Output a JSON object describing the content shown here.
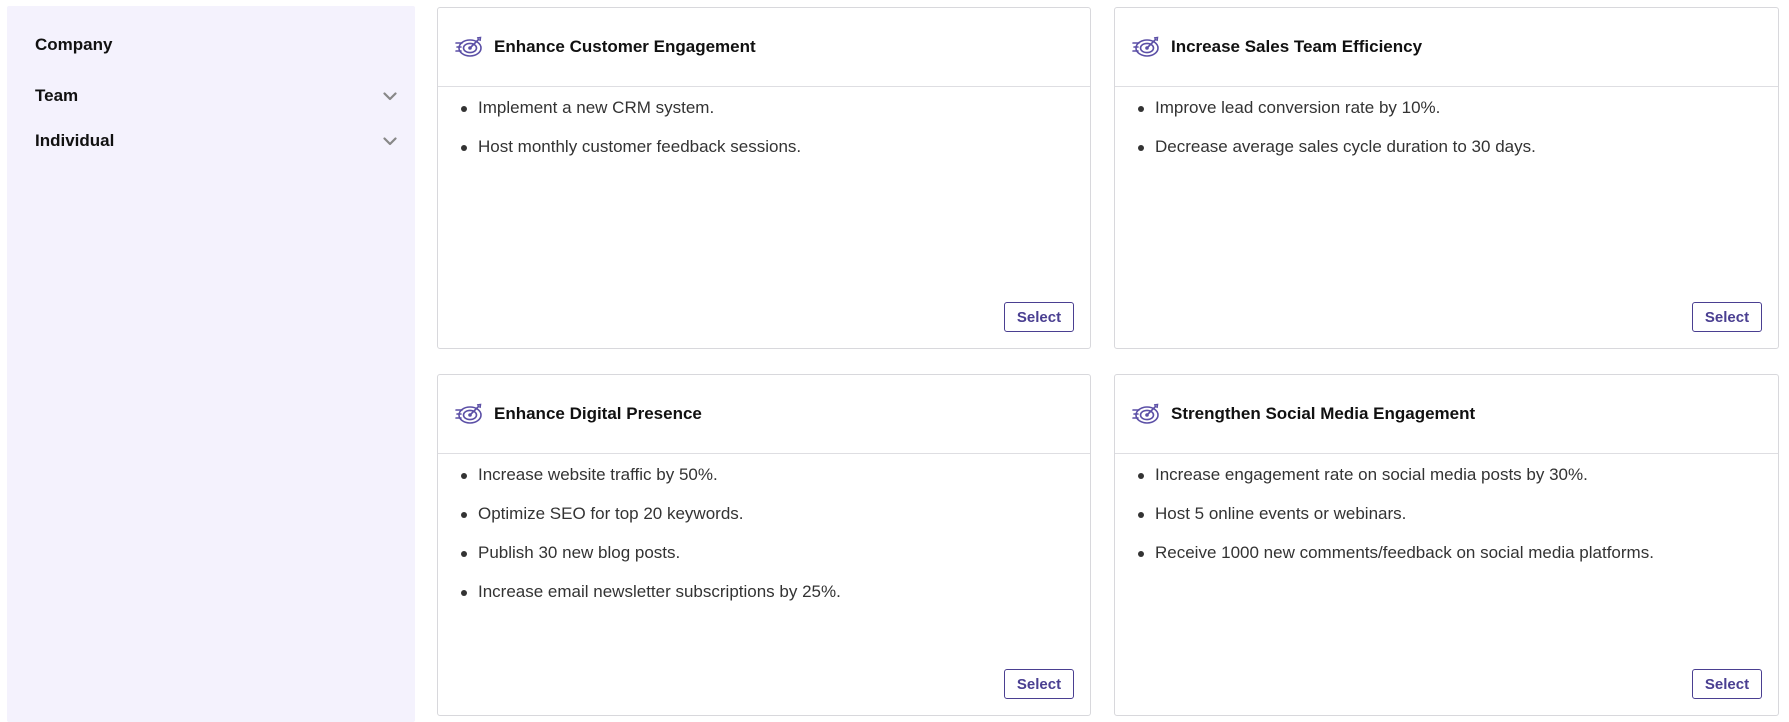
{
  "sidebar": {
    "items": [
      {
        "label": "Company"
      },
      {
        "label": "Team",
        "icon": "chevron-down-icon"
      },
      {
        "label": "Individual",
        "icon": "chevron-down-icon"
      }
    ]
  },
  "colors": {
    "sidebar_bg": "#f4f2fd",
    "accent": "#4a3f91",
    "icon": "#5b4fa6"
  },
  "cards": [
    {
      "title": "Enhance Customer Engagement",
      "icon": "target-arrow-icon",
      "items": [
        "Implement a new CRM system.",
        "Host monthly customer feedback sessions."
      ],
      "button": "Select"
    },
    {
      "title": "Increase Sales Team Efficiency",
      "icon": "target-arrow-icon",
      "items": [
        "Improve lead conversion rate by 10%.",
        "Decrease average sales cycle duration to 30 days."
      ],
      "button": "Select"
    },
    {
      "title": "Enhance Digital Presence",
      "icon": "target-arrow-icon",
      "items": [
        "Increase website traffic by 50%.",
        "Optimize SEO for top 20 keywords.",
        "Publish 30 new blog posts.",
        "Increase email newsletter subscriptions by 25%."
      ],
      "button": "Select"
    },
    {
      "title": "Strengthen Social Media Engagement",
      "icon": "target-arrow-icon",
      "items": [
        "Increase engagement rate on social media posts by 30%.",
        "Host 5 online events or webinars.",
        "Receive 1000 new comments/feedback on social media platforms."
      ],
      "button": "Select"
    }
  ]
}
